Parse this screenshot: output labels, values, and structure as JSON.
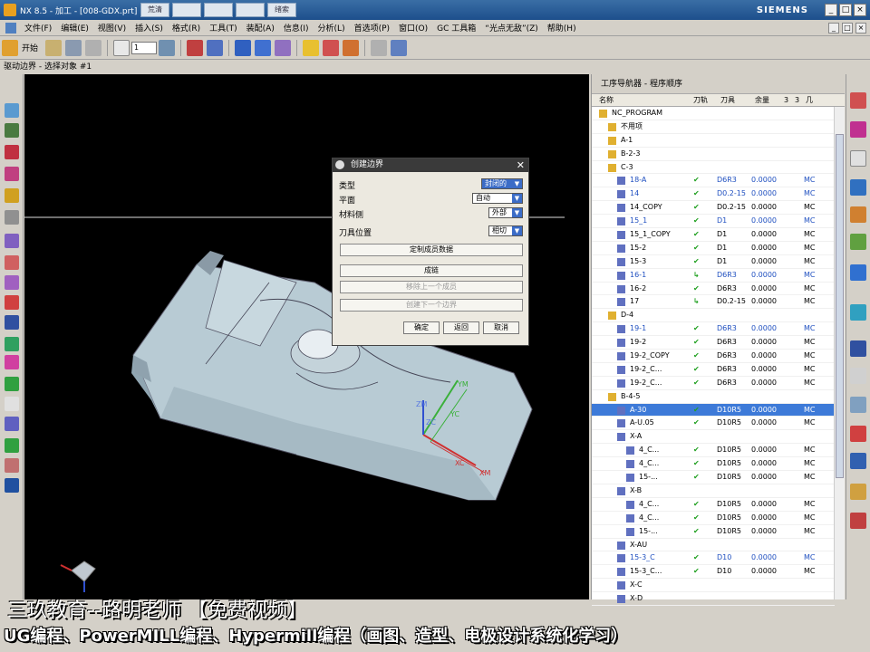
{
  "window": {
    "title": "NX 8.5 - 加工 - [008-GDX.prt]",
    "tabs": [
      "荒清",
      "",
      "",
      "",
      "绪索"
    ],
    "brand": "SIEMENS",
    "controls": [
      "_",
      "□",
      "×"
    ]
  },
  "menubar": {
    "items": [
      "文件(F)",
      "编辑(E)",
      "视图(V)",
      "插入(S)",
      "格式(R)",
      "工具(T)",
      "装配(A)",
      "信息(I)",
      "分析(L)",
      "首选项(P)",
      "窗口(O)",
      "GC 工具箱",
      "“光点无敌”(Z)",
      "帮助(H)"
    ],
    "start_label": "开始",
    "combo_value": "1"
  },
  "statusline": "驱动边界 - 选择对象 #1",
  "dialog": {
    "title": "创建边界",
    "rows": [
      {
        "label": "类型",
        "value": "封闭的"
      },
      {
        "label": "平面",
        "value": "自动"
      },
      {
        "label": "材料侧",
        "value": "外部"
      },
      {
        "label": "刀具位置",
        "value": "相切"
      }
    ],
    "buttons": [
      {
        "label": "定制成员数据",
        "enabled": true
      },
      {
        "label": "成链",
        "enabled": true
      },
      {
        "label": "移除上一个成员",
        "enabled": false
      },
      {
        "label": "创建下一个边界",
        "enabled": false
      }
    ],
    "ok": "确定",
    "back": "返回",
    "cancel": "取消"
  },
  "navigator": {
    "title": "工序导航器 - 程序顺序",
    "columns": [
      "名称",
      "刀轨",
      "刀具",
      "余量",
      "3",
      "3",
      "几"
    ],
    "rows": [
      {
        "name": "NC_PROGRAM",
        "indent": 0,
        "toolpath": "",
        "tool": "",
        "stock": "",
        "geom": "",
        "color": "black"
      },
      {
        "name": "不用项",
        "indent": 1,
        "toolpath": "",
        "tool": "",
        "stock": "",
        "geom": "",
        "color": "black"
      },
      {
        "name": "A-1",
        "indent": 1,
        "toolpath": "",
        "tool": "",
        "stock": "",
        "geom": "",
        "color": "black"
      },
      {
        "name": "B-2-3",
        "indent": 1,
        "toolpath": "",
        "tool": "",
        "stock": "",
        "geom": "",
        "color": "black"
      },
      {
        "name": "C-3",
        "indent": 1,
        "toolpath": "",
        "tool": "",
        "stock": "",
        "geom": "",
        "color": "black"
      },
      {
        "name": "18-A",
        "indent": 2,
        "toolpath": "✔",
        "tool": "D6R3",
        "stock": "0.0000",
        "geom": "MC",
        "color": "blue"
      },
      {
        "name": "14",
        "indent": 2,
        "toolpath": "✔",
        "tool": "D0.2-15",
        "stock": "0.0000",
        "geom": "MC",
        "color": "blue"
      },
      {
        "name": "14_COPY",
        "indent": 2,
        "toolpath": "✔",
        "tool": "D0.2-15",
        "stock": "0.0000",
        "geom": "MC",
        "color": "black"
      },
      {
        "name": "15_1",
        "indent": 2,
        "toolpath": "✔",
        "tool": "D1",
        "stock": "0.0000",
        "geom": "MC",
        "color": "blue"
      },
      {
        "name": "15_1_COPY",
        "indent": 2,
        "toolpath": "✔",
        "tool": "D1",
        "stock": "0.0000",
        "geom": "MC",
        "color": "black"
      },
      {
        "name": "15-2",
        "indent": 2,
        "toolpath": "✔",
        "tool": "D1",
        "stock": "0.0000",
        "geom": "MC",
        "color": "black"
      },
      {
        "name": "15-3",
        "indent": 2,
        "toolpath": "✔",
        "tool": "D1",
        "stock": "0.0000",
        "geom": "MC",
        "color": "black"
      },
      {
        "name": "16-1",
        "indent": 2,
        "toolpath": "↳",
        "tool": "D6R3",
        "stock": "0.0000",
        "geom": "MC",
        "color": "blue"
      },
      {
        "name": "16-2",
        "indent": 2,
        "toolpath": "✔",
        "tool": "D6R3",
        "stock": "0.0000",
        "geom": "MC",
        "color": "black"
      },
      {
        "name": "17",
        "indent": 2,
        "toolpath": "↳",
        "tool": "D0.2-15",
        "stock": "0.0000",
        "geom": "MC",
        "color": "black"
      },
      {
        "name": "D-4",
        "indent": 1,
        "toolpath": "",
        "tool": "",
        "stock": "",
        "geom": "",
        "color": "black"
      },
      {
        "name": "19-1",
        "indent": 2,
        "toolpath": "✔",
        "tool": "D6R3",
        "stock": "0.0000",
        "geom": "MC",
        "color": "blue"
      },
      {
        "name": "19-2",
        "indent": 2,
        "toolpath": "✔",
        "tool": "D6R3",
        "stock": "0.0000",
        "geom": "MC",
        "color": "black"
      },
      {
        "name": "19-2_COPY",
        "indent": 2,
        "toolpath": "✔",
        "tool": "D6R3",
        "stock": "0.0000",
        "geom": "MC",
        "color": "black"
      },
      {
        "name": "19-2_C...",
        "indent": 2,
        "toolpath": "✔",
        "tool": "D6R3",
        "stock": "0.0000",
        "geom": "MC",
        "color": "black"
      },
      {
        "name": "19-2_C...",
        "indent": 2,
        "toolpath": "✔",
        "tool": "D6R3",
        "stock": "0.0000",
        "geom": "MC",
        "color": "black"
      },
      {
        "name": "B-4-5",
        "indent": 1,
        "toolpath": "",
        "tool": "",
        "stock": "",
        "geom": "",
        "color": "black"
      },
      {
        "name": "A-30",
        "indent": 2,
        "toolpath": "✔",
        "tool": "D10R5",
        "stock": "0.0000",
        "geom": "MC",
        "color": "black",
        "selected": true
      },
      {
        "name": "A-U.05",
        "indent": 2,
        "toolpath": "✔",
        "tool": "D10R5",
        "stock": "0.0000",
        "geom": "MC",
        "color": "black"
      },
      {
        "name": "X-A",
        "indent": 2,
        "toolpath": "",
        "tool": "",
        "stock": "",
        "geom": "",
        "color": "black"
      },
      {
        "name": "4_C...",
        "indent": 3,
        "toolpath": "✔",
        "tool": "D10R5",
        "stock": "0.0000",
        "geom": "MC",
        "color": "black"
      },
      {
        "name": "4_C...",
        "indent": 3,
        "toolpath": "✔",
        "tool": "D10R5",
        "stock": "0.0000",
        "geom": "MC",
        "color": "black"
      },
      {
        "name": "15-...",
        "indent": 3,
        "toolpath": "✔",
        "tool": "D10R5",
        "stock": "0.0000",
        "geom": "MC",
        "color": "black"
      },
      {
        "name": "X-B",
        "indent": 2,
        "toolpath": "",
        "tool": "",
        "stock": "",
        "geom": "",
        "color": "black"
      },
      {
        "name": "4_C...",
        "indent": 3,
        "toolpath": "✔",
        "tool": "D10R5",
        "stock": "0.0000",
        "geom": "MC",
        "color": "black"
      },
      {
        "name": "4_C...",
        "indent": 3,
        "toolpath": "✔",
        "tool": "D10R5",
        "stock": "0.0000",
        "geom": "MC",
        "color": "black"
      },
      {
        "name": "15-...",
        "indent": 3,
        "toolpath": "✔",
        "tool": "D10R5",
        "stock": "0.0000",
        "geom": "MC",
        "color": "black"
      },
      {
        "name": "X-AU",
        "indent": 2,
        "toolpath": "",
        "tool": "",
        "stock": "",
        "geom": "",
        "color": "black"
      },
      {
        "name": "15-3_C",
        "indent": 2,
        "toolpath": "✔",
        "tool": "D10",
        "stock": "0.0000",
        "geom": "MC",
        "color": "blue"
      },
      {
        "name": "15-3_C...",
        "indent": 2,
        "toolpath": "✔",
        "tool": "D10",
        "stock": "0.0000",
        "geom": "MC",
        "color": "black"
      },
      {
        "name": "X-C",
        "indent": 2,
        "toolpath": "",
        "tool": "",
        "stock": "",
        "geom": "",
        "color": "black"
      },
      {
        "name": "X-D",
        "indent": 2,
        "toolpath": "",
        "tool": "",
        "stock": "",
        "geom": "",
        "color": "black"
      }
    ]
  },
  "axes": {
    "zm": "ZM",
    "ym": "YM",
    "xm": "XM",
    "zc": "ZC",
    "yc": "YC",
    "xc": "XC"
  },
  "captions": {
    "line1": "三玖教育--路明老师  【免费视频】",
    "line2": "UG编程、PowerMILL编程、Hypermill编程（画图、造型、电极设计系统化学习）"
  }
}
